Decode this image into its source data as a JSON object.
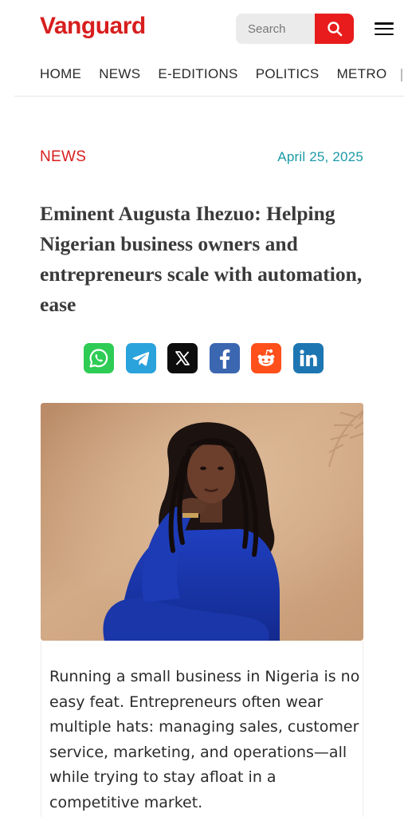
{
  "header": {
    "logo": "Vanguard",
    "search_placeholder": "Search",
    "brand_color": "#d81e1e"
  },
  "nav": {
    "items": [
      "HOME",
      "NEWS",
      "E-EDITIONS",
      "POLITICS",
      "METRO"
    ]
  },
  "article": {
    "category": "NEWS",
    "date": "April 25, 2025",
    "headline": "Eminent Augusta Ihezuo: Helping Nigerian business owners and entrepreneurs scale with automation, ease",
    "body": "Running a small business in Nigeria is no easy feat. Entrepreneurs often wear multiple hats: managing sales, customer service, marketing, and operations—all while trying to stay afloat in a competitive market."
  },
  "share": {
    "icons": [
      "whatsapp-icon",
      "telegram-icon",
      "x-icon",
      "facebook-icon",
      "reddit-icon",
      "linkedin-icon"
    ]
  },
  "colors": {
    "date": "#1b9aa8",
    "headline": "#3a3a3a"
  }
}
